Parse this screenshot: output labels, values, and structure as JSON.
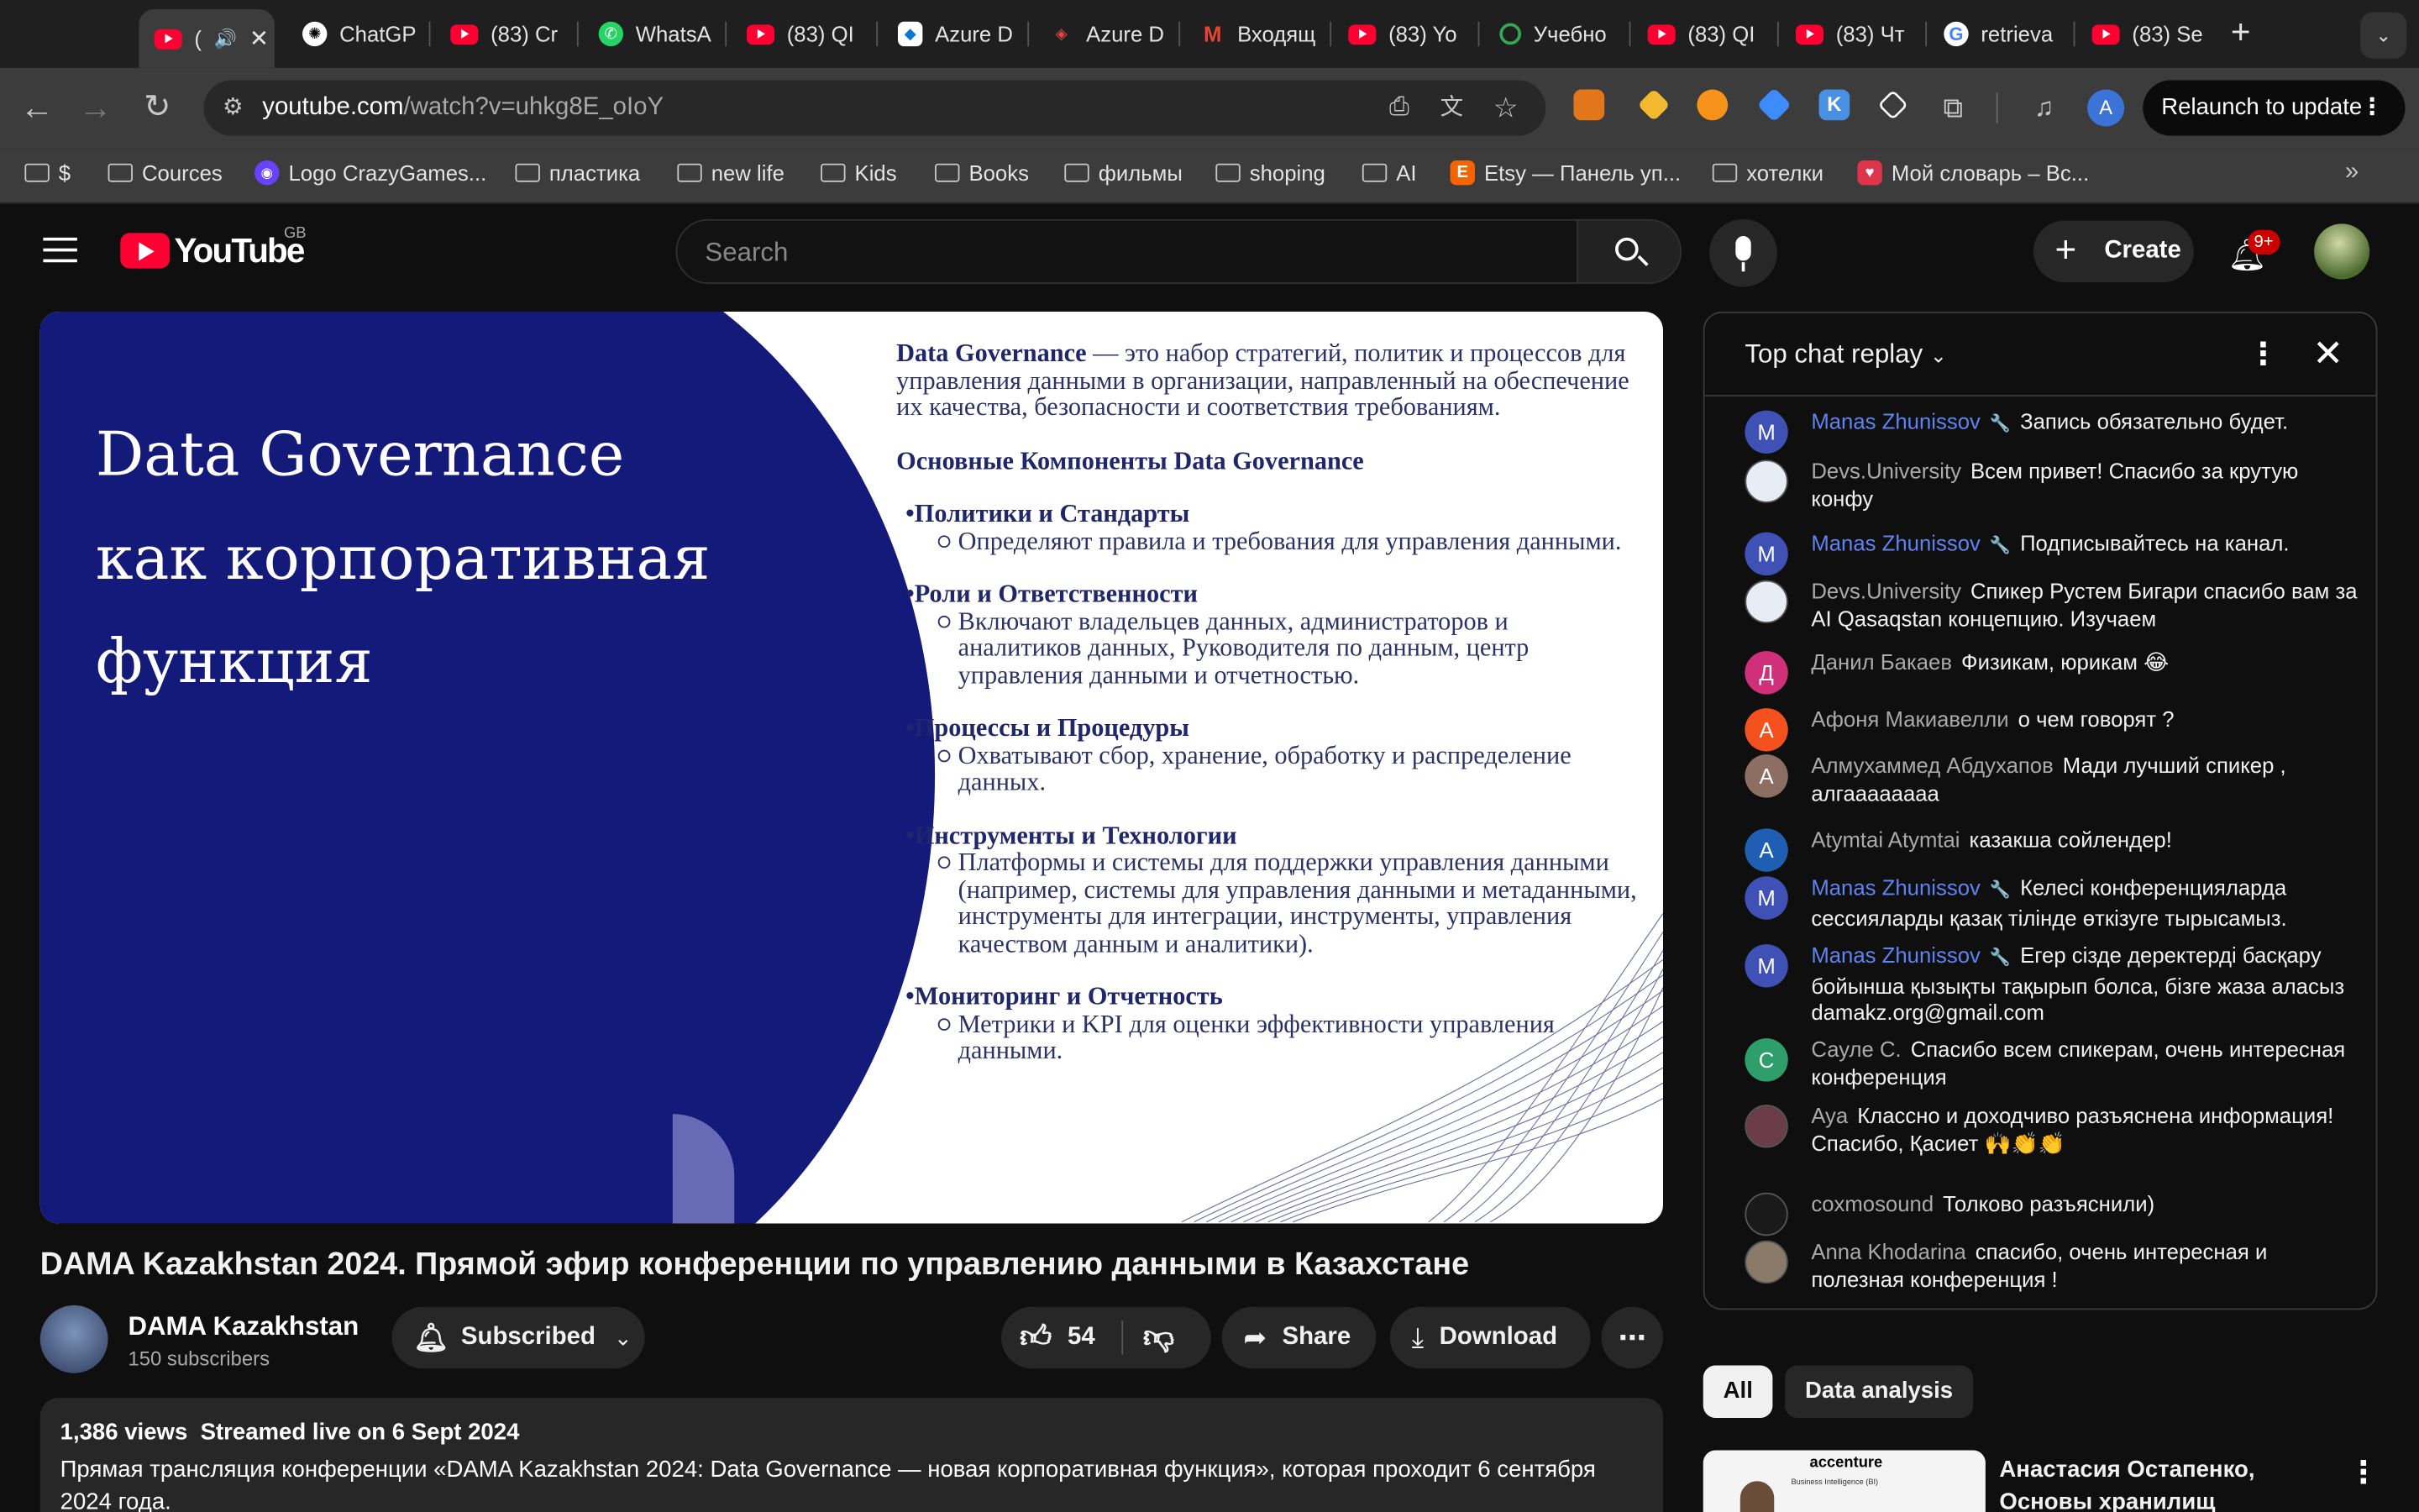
{
  "browser": {
    "tabs": [
      {
        "title": "(",
        "icon": "youtube"
      },
      {
        "title": "ChatGP",
        "icon": "chatgpt"
      },
      {
        "title": "(83) Cr",
        "icon": "youtube"
      },
      {
        "title": "WhatsA",
        "icon": "whatsapp"
      },
      {
        "title": "(83) QI",
        "icon": "youtube"
      },
      {
        "title": "Azure D",
        "icon": "azure"
      },
      {
        "title": "Azure D",
        "icon": "azure-devops"
      },
      {
        "title": "Входящ",
        "icon": "gmail"
      },
      {
        "title": "(83) Yo",
        "icon": "youtube"
      },
      {
        "title": "Учебно",
        "icon": "search"
      },
      {
        "title": "(83) QI",
        "icon": "youtube"
      },
      {
        "title": "(83) Чт",
        "icon": "youtube"
      },
      {
        "title": "retrieva",
        "icon": "google"
      },
      {
        "title": "(83) Se",
        "icon": "youtube"
      }
    ],
    "url_host": "youtube.com",
    "url_path": "/watch?v=uhkg8E_oIoY",
    "relaunch_label": "Relaunch to update",
    "profile_initial": "A",
    "bookmarks": [
      {
        "label": "$",
        "icon": "folder"
      },
      {
        "label": "Cources",
        "icon": "folder"
      },
      {
        "label": "Logo CrazyGames...",
        "icon": "crazygames"
      },
      {
        "label": "пластика",
        "icon": "folder"
      },
      {
        "label": "new life",
        "icon": "folder"
      },
      {
        "label": "Kids",
        "icon": "folder"
      },
      {
        "label": "Books",
        "icon": "folder"
      },
      {
        "label": "фильмы",
        "icon": "folder"
      },
      {
        "label": "shoping",
        "icon": "folder"
      },
      {
        "label": "AI",
        "icon": "folder"
      },
      {
        "label": "Etsy — Панель уп...",
        "icon": "etsy"
      },
      {
        "label": "хотелки",
        "icon": "folder"
      },
      {
        "label": "Мой словарь – Вс...",
        "icon": "dictionary"
      }
    ]
  },
  "youtube": {
    "logo_text": "YouTube",
    "region": "GB",
    "search_placeholder": "Search",
    "create_label": "Create",
    "notif_count": "9+"
  },
  "slide": {
    "title_lines": [
      "Data Governance",
      "как корпоративная",
      "функция"
    ],
    "intro_bold": "Data Governance",
    "intro_text": " — это набор стратегий, политик и процессов для управления данными в организации, направленный на обеспечение их качества, безопасности и соответствия требованиям.",
    "components_heading": "Основные Компоненты Data Governance",
    "components": [
      {
        "title": "•Политики и Стандарты",
        "text": "Определяют правила и требования для управления данными."
      },
      {
        "title": "•Роли и Ответственности",
        "text": "Включают владельцев данных, администраторов и аналитиков данных, Руководителя по данным, центр управления данными и отчетностью."
      },
      {
        "title": "•Процессы и Процедуры",
        "text": "Охватывают сбор, хранение, обработку и распределение данных."
      },
      {
        "title": "•Инструменты и Технологии",
        "text": "Платформы и системы для поддержки управления данными (например, системы для управления данными и метаданными, инструменты для интеграции, инструменты, управления качеством данным и аналитики)."
      },
      {
        "title": "•Мониторинг и Отчетность",
        "text": "Метрики и KPI для оценки эффективности управления данными."
      }
    ]
  },
  "video": {
    "title": "DAMA Kazakhstan 2024. Прямой эфир конференции по управлению данными в Казахстане",
    "channel": "DAMA Kazakhstan",
    "subscribers": "150 subscribers",
    "subscribe_label": "Subscribed",
    "likes": "54",
    "share_label": "Share",
    "download_label": "Download",
    "views": "1,386 views",
    "streamed": "Streamed live on 6 Sept 2024",
    "description": "Прямая трансляция конференции «DAMA Kazakhstan 2024: Data Governance — новая корпоративная функция», которая проходит 6 сентября 2024 года."
  },
  "chat": {
    "title": "Top chat replay",
    "messages": [
      {
        "author": "Manas Zhunissov",
        "mod": true,
        "avatar": "M",
        "color": "#3f51b5",
        "text": "Запись обязательно будет."
      },
      {
        "author": "Devs.University",
        "mod": false,
        "avatar": "",
        "color": "#e8edf5",
        "text": "Всем привет! Спасибо за крутую конфу"
      },
      {
        "author": "Manas Zhunissov",
        "mod": true,
        "avatar": "M",
        "color": "#3f51b5",
        "text": "Подписывайтесь на канал."
      },
      {
        "author": "Devs.University",
        "mod": false,
        "avatar": "",
        "color": "#e8edf5",
        "text": "Спикер Рустем Бигари спасибо вам за AI Qasaqstan концепцию. Изучаем"
      },
      {
        "author": "Данил Бакаев",
        "mod": false,
        "avatar": "Д",
        "color": "#d0307a",
        "text": "Физикам, юрикам 😂"
      },
      {
        "author": "Афоня Макиавелли",
        "mod": false,
        "avatar": "А",
        "color": "#f4511e",
        "text": "о чем говорят ?"
      },
      {
        "author": "Алмухаммед Абдухапов",
        "mod": false,
        "avatar": "А",
        "color": "#8d6e63",
        "text": "Мади лучший спикер , алгаааааааа"
      },
      {
        "author": "Atymtai Atymtai",
        "mod": false,
        "avatar": "A",
        "color": "#1e5fb4",
        "text": "казакша сойлендер!"
      },
      {
        "author": "Manas Zhunissov",
        "mod": true,
        "avatar": "M",
        "color": "#3f51b5",
        "text": "Келесі конференцияларда сессияларды қазақ тілінде өткізуге тырысамыз."
      },
      {
        "author": "Manas Zhunissov",
        "mod": true,
        "avatar": "M",
        "color": "#3f51b5",
        "text": "Егер сізде деректерді басқару бойынша қызықты тақырып болса, бізге жаза аласыз damakz.org@gmail.com"
      },
      {
        "author": "Сауле С.",
        "mod": false,
        "avatar": "С",
        "color": "#2e9e6a",
        "text": "Спасибо всем спикерам, очень интересная конференция"
      },
      {
        "author": "Aya",
        "mod": false,
        "avatar": "",
        "color": "#6b3d4a",
        "text": "Классно и доходчиво разъяснена информация! Спасибо, Қасиет 🙌👏👏"
      },
      {
        "author": "coxmosound",
        "mod": false,
        "avatar": "",
        "color": "#1a1a1a",
        "text": "Толково разъяснили)"
      },
      {
        "author": "Anna Khodarina",
        "mod": false,
        "avatar": "",
        "color": "#8a7a6a",
        "text": "спасибо, очень интересная и полезная конференция !"
      }
    ]
  },
  "chips": [
    "All",
    "Data analysis"
  ],
  "recommendation": {
    "thumb_brand": "accenture",
    "thumb_caption": "Business Intelligence (BI)",
    "title": "Анастасия Остапенко, Основы хранилищ данных...."
  }
}
